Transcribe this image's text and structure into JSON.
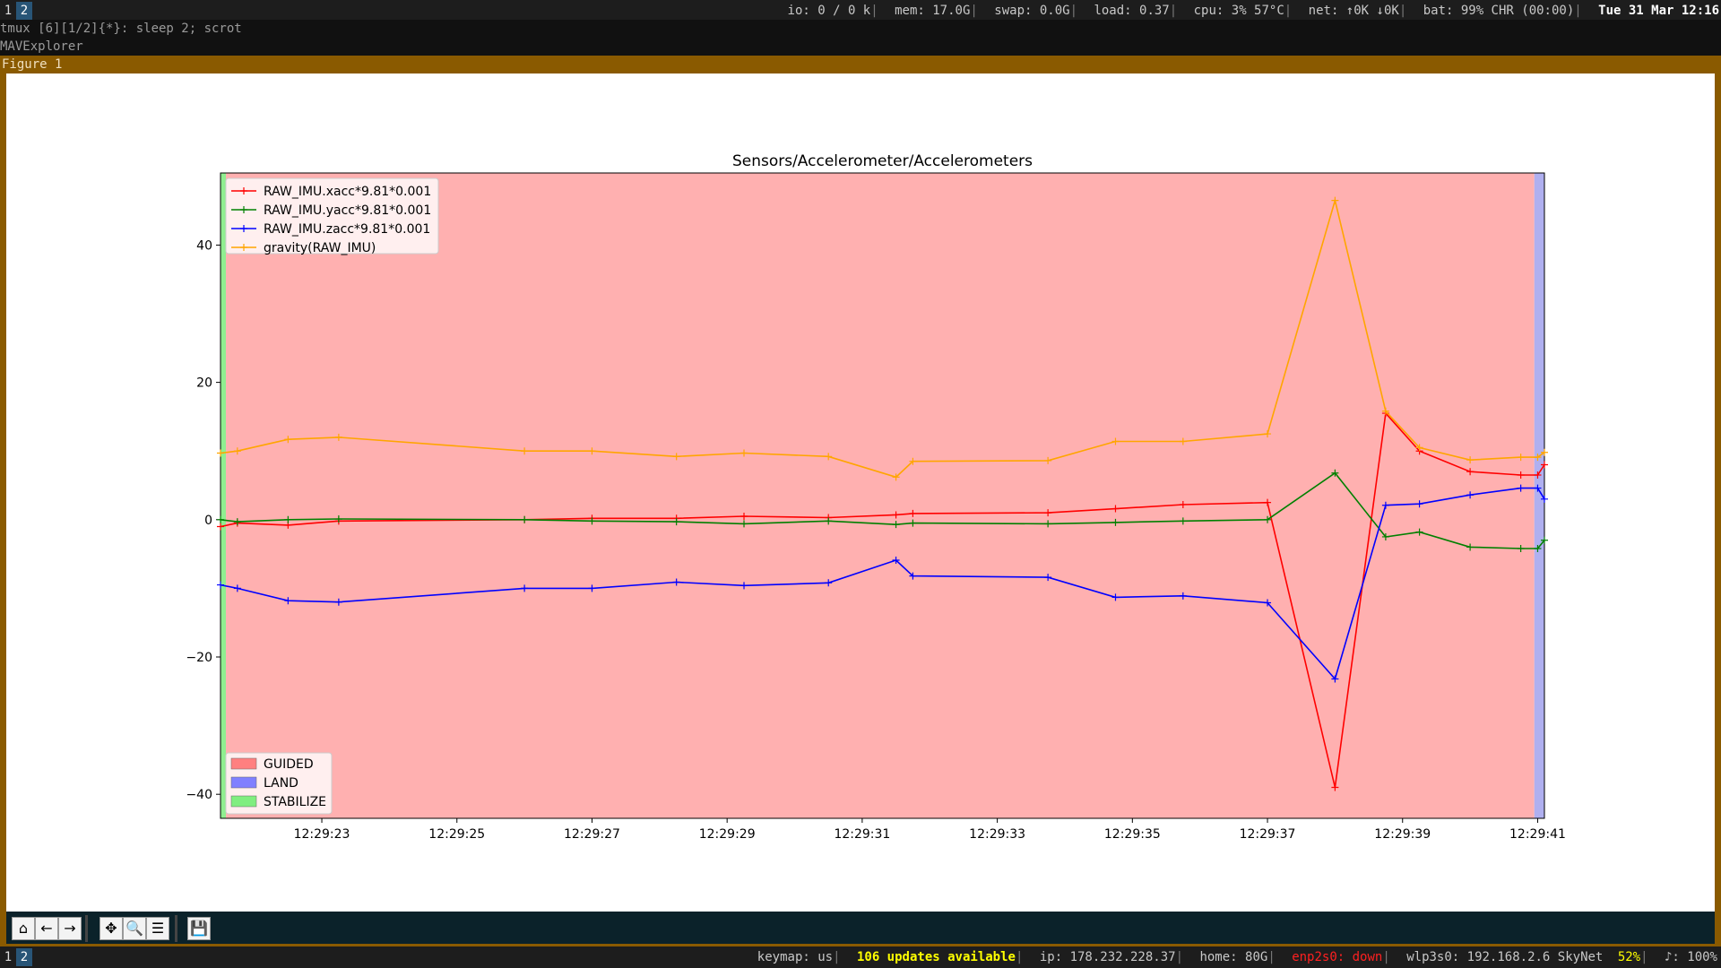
{
  "topbar": {
    "workspaces": [
      "1",
      "2"
    ],
    "active_workspace": "2",
    "status": {
      "io": "io: 0   /   0 k",
      "mem": "mem: 17.0G",
      "swap": "swap: 0.0G",
      "load": "load: 0.37",
      "cpu": "cpu:   3%   57°C",
      "net": "net:   ↑0K  ↓0K",
      "bat": "bat: 99% CHR (00:00)",
      "datetime": "Tue 31 Mar 12:16"
    }
  },
  "tmux_line": "tmux [6][1/2]{*}:  sleep 2; scrot",
  "app_line": "MAVExplorer",
  "window": {
    "title": "Figure 1"
  },
  "chart_data": {
    "type": "line",
    "title": "Sensors/Accelerometer/Accelerometers",
    "xlabel": "",
    "ylabel": "",
    "x_ticks": [
      "12:29:23",
      "12:29:25",
      "12:29:27",
      "12:29:29",
      "12:29:31",
      "12:29:33",
      "12:29:35",
      "12:29:37",
      "12:29:39",
      "12:29:41"
    ],
    "x_tick_seconds": [
      23,
      25,
      27,
      29,
      31,
      33,
      35,
      37,
      39,
      41
    ],
    "xlim_seconds": [
      21.5,
      41.1
    ],
    "ylim": [
      -43.5,
      50.5
    ],
    "y_ticks": [
      -40,
      -20,
      0,
      20,
      40
    ],
    "x_seconds": [
      21.5,
      21.75,
      22.5,
      23.25,
      26.0,
      27.0,
      28.25,
      29.25,
      30.5,
      31.5,
      31.75,
      33.75,
      34.75,
      35.75,
      37.0,
      38.0,
      38.75,
      39.25,
      40.0,
      40.75,
      41.0,
      41.1
    ],
    "series": [
      {
        "name": "RAW_IMU.xacc*9.81*0.001",
        "color": "#ff0000",
        "values": [
          -1.0,
          -0.5,
          -0.8,
          -0.2,
          0.0,
          0.2,
          0.2,
          0.5,
          0.3,
          0.7,
          0.9,
          1.0,
          1.6,
          2.2,
          2.5,
          -39.0,
          15.5,
          10.0,
          7.0,
          6.5,
          6.5,
          8.0
        ]
      },
      {
        "name": "RAW_IMU.yacc*9.81*0.001",
        "color": "#008000",
        "values": [
          0.0,
          -0.3,
          0.0,
          0.1,
          0.0,
          -0.2,
          -0.3,
          -0.6,
          -0.2,
          -0.7,
          -0.5,
          -0.6,
          -0.4,
          -0.2,
          0.0,
          6.8,
          -2.5,
          -1.8,
          -4.0,
          -4.2,
          -4.2,
          -3.0
        ]
      },
      {
        "name": "RAW_IMU.zacc*9.81*0.001",
        "color": "#0000ff",
        "values": [
          -9.5,
          -10.0,
          -11.8,
          -12.0,
          -10.0,
          -10.0,
          -9.1,
          -9.6,
          -9.2,
          -5.9,
          -8.2,
          -8.4,
          -11.3,
          -11.1,
          -12.1,
          -23.2,
          2.1,
          2.3,
          3.6,
          4.6,
          4.6,
          3.0
        ]
      },
      {
        "name": "gravity(RAW_IMU)",
        "color": "#ffa500",
        "values": [
          9.7,
          10.0,
          11.7,
          12.0,
          10.0,
          10.0,
          9.2,
          9.7,
          9.2,
          6.2,
          8.5,
          8.6,
          11.4,
          11.4,
          12.5,
          46.5,
          15.8,
          10.5,
          8.7,
          9.1,
          9.1,
          9.8
        ]
      }
    ],
    "legend_lines_position": "top-left",
    "mode_regions": [
      {
        "mode": "STABILIZE",
        "color": "#90ee90",
        "from": 21.5,
        "to": 21.58
      },
      {
        "mode": "GUIDED",
        "color": "#ffb0b0",
        "from": 21.58,
        "to": 40.95
      },
      {
        "mode": "LAND",
        "color": "#b0b0f0",
        "from": 40.95,
        "to": 41.1
      }
    ],
    "legend_modes": [
      {
        "label": "GUIDED",
        "color": "#ff8080"
      },
      {
        "label": "LAND",
        "color": "#8080ff"
      },
      {
        "label": "STABILIZE",
        "color": "#80ee80"
      }
    ],
    "legend_modes_position": "bottom-left"
  },
  "toolbar": {
    "buttons": [
      {
        "name": "home-button",
        "icon": "home-icon",
        "glyph": "⌂"
      },
      {
        "name": "back-button",
        "icon": "arrow-left-icon",
        "glyph": "←"
      },
      {
        "name": "forward-button",
        "icon": "arrow-right-icon",
        "glyph": "→"
      },
      {
        "name": "pan-button",
        "icon": "move-icon",
        "glyph": "✥"
      },
      {
        "name": "zoom-button",
        "icon": "magnifier-icon",
        "glyph": "🔍"
      },
      {
        "name": "configure-button",
        "icon": "sliders-icon",
        "glyph": "☰"
      },
      {
        "name": "save-button",
        "icon": "floppy-icon",
        "glyph": "💾"
      }
    ]
  },
  "bottombar": {
    "workspaces": [
      "1",
      "2"
    ],
    "active_workspace": "2",
    "keymap": "keymap: us",
    "updates": "106 updates available",
    "ip": "ip: 178.232.228.37",
    "home": "home: 80G",
    "eth": "enp2s0: down",
    "wifi": "wlp3s0: 192.168.2.6  SkyNet",
    "wifi_pct": "52%",
    "volume": "♪: 100%",
    "colors": {
      "updates": "#ffff00",
      "eth": "#ff2020",
      "wifi_pct": "#ffff00"
    }
  }
}
